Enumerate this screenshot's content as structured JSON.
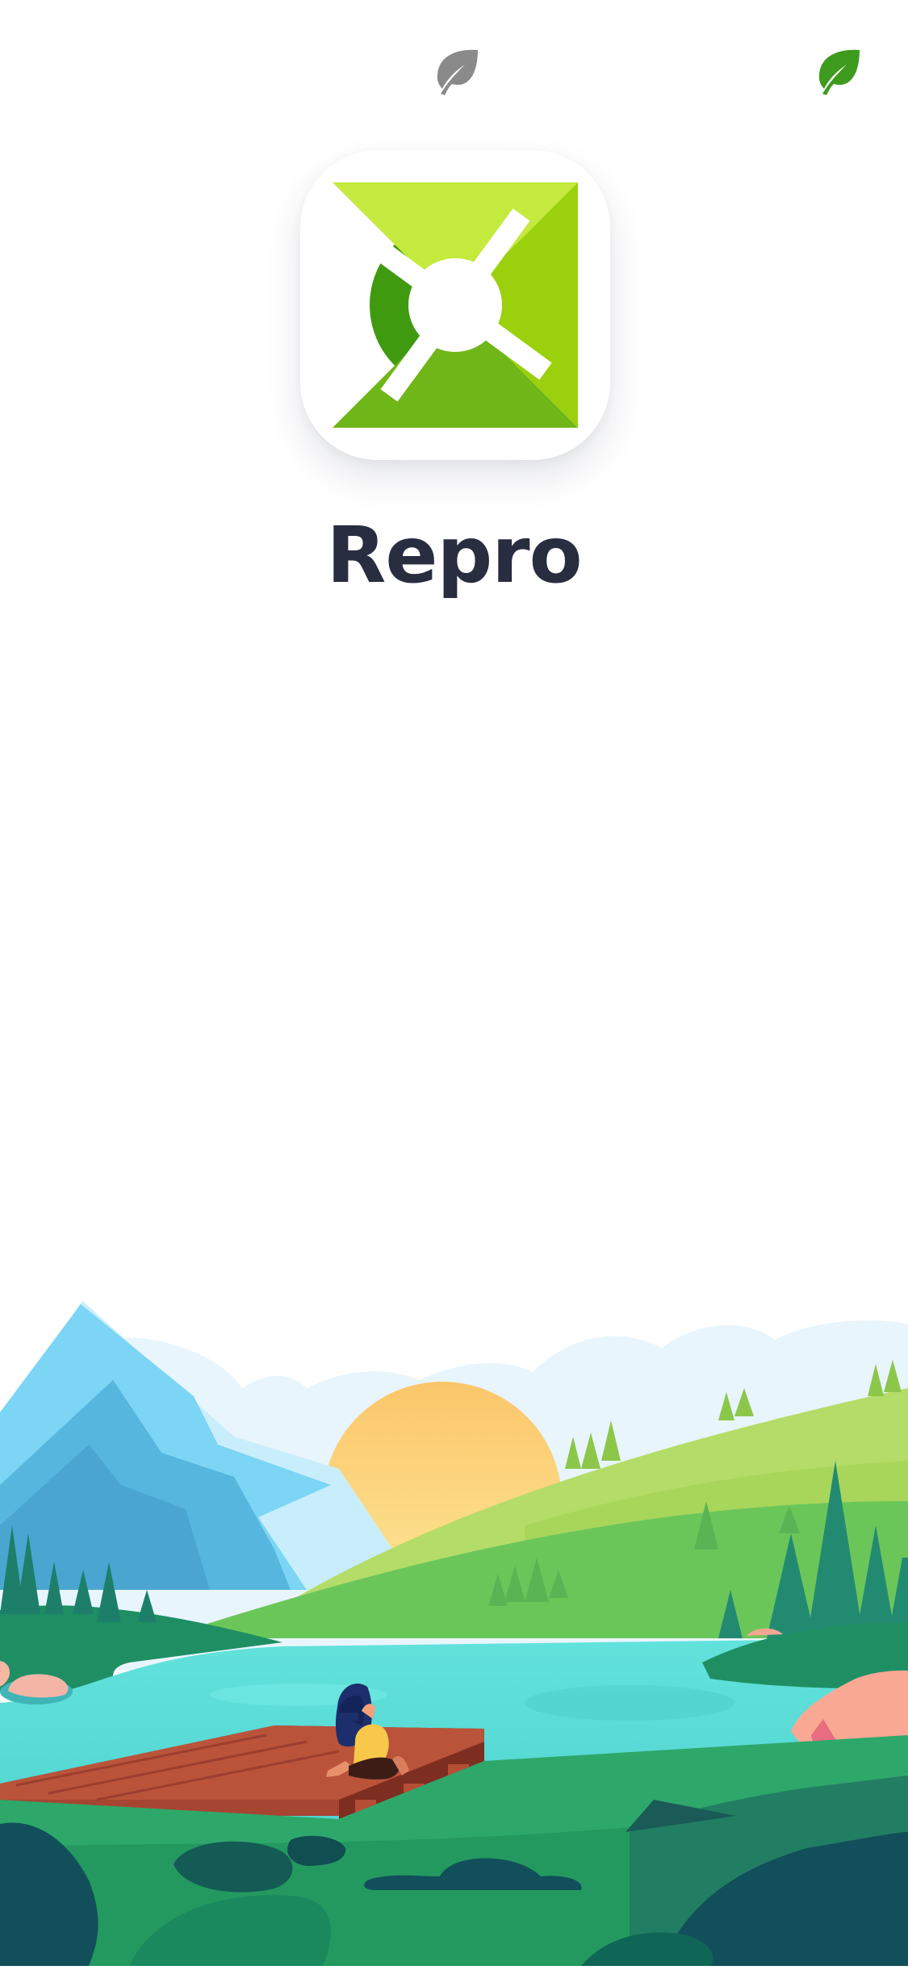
{
  "app": {
    "name": "Repro"
  },
  "icons": {
    "status_left": "leaf-icon",
    "status_right": "leaf-icon",
    "app_logo": "repro-logo-icon"
  },
  "colors": {
    "leaf_inactive": "#8a8a8a",
    "leaf_active": "#3e9b1e",
    "logo_dark": "#3f9a0f",
    "logo_mid": "#6fb618",
    "logo_light": "#9bd00d",
    "logo_lime": "#c3ea3c",
    "title_text": "#282d40",
    "lake": "#5ee0dc",
    "dock": "#a74a35"
  },
  "illustration": {
    "name": "lake-landscape-illustration"
  }
}
